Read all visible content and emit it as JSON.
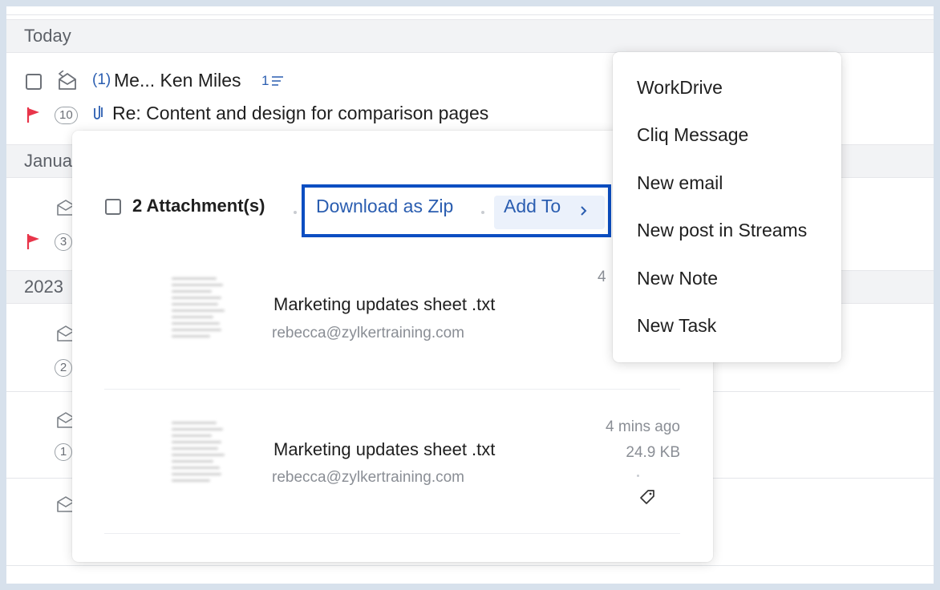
{
  "mail_list": {
    "groups": [
      {
        "label": "Today"
      },
      {
        "label": "Janua"
      },
      {
        "label": "2023"
      }
    ],
    "thread": {
      "thread_count": "(1)",
      "sender": "Me... Ken Miles",
      "reply_count": "1",
      "message_count": "10",
      "subject": "Re: Content and design for comparison pages"
    },
    "row_counts": [
      "3",
      "2",
      "1"
    ]
  },
  "attachments_popup": {
    "header_label": "2 Attachment(s)",
    "download_zip_label": "Download as Zip",
    "add_to_label": "Add To",
    "files": [
      {
        "name": "Marketing updates sheet .txt",
        "sender": "rebecca@zylkertraining.com",
        "time": "4",
        "size": ""
      },
      {
        "name": "Marketing updates sheet .txt",
        "sender": "rebecca@zylkertraining.com",
        "time": "4 mins ago",
        "size": "24.9 KB"
      }
    ]
  },
  "add_to_menu": {
    "items": [
      {
        "label": "WorkDrive"
      },
      {
        "label": "Cliq Message"
      },
      {
        "label": "New email"
      },
      {
        "label": "New post in Streams"
      },
      {
        "label": "New Note"
      },
      {
        "label": "New Task"
      }
    ]
  },
  "colors": {
    "accent": "#1a58c4",
    "highlight_border": "#0c4ec2",
    "flag": "#e8354a",
    "link": "#2a5db0"
  }
}
